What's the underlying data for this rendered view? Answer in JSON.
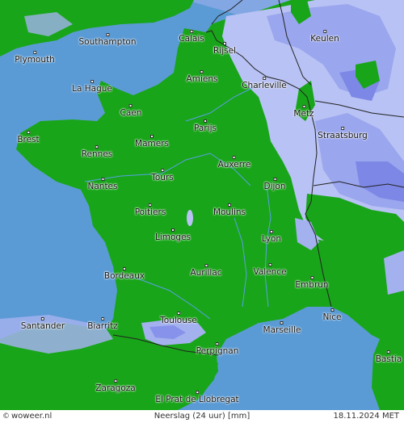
{
  "footer": {
    "credit_symbol": "©",
    "credit": "woweer.nl",
    "legend": "Neerslag (24 uur) [mm]",
    "date": "18.11.2024",
    "timezone": "MET"
  },
  "colors": {
    "sea": "#5b9bd5",
    "land": "#19a519",
    "rain_light": "#b8c2f4",
    "rain_medium": "#9aa6ee",
    "rain_heavy": "#7d88e6",
    "border": "#222222",
    "river": "#5aa0e8"
  },
  "cities": [
    {
      "id": "southampton",
      "name": "Southampton"
    },
    {
      "id": "plymouth",
      "name": "Plymouth"
    },
    {
      "id": "calais",
      "name": "Calais"
    },
    {
      "id": "rijsel",
      "name": "Rijsel"
    },
    {
      "id": "keulen",
      "name": "Keulen"
    },
    {
      "id": "amiens",
      "name": "Amiens"
    },
    {
      "id": "charleville",
      "name": "Charleville"
    },
    {
      "id": "la-hague",
      "name": "La Hague"
    },
    {
      "id": "caen",
      "name": "Caen"
    },
    {
      "id": "metz",
      "name": "Metz"
    },
    {
      "id": "parijs",
      "name": "Parijs"
    },
    {
      "id": "brest",
      "name": "Brest"
    },
    {
      "id": "mamers",
      "name": "Mamers"
    },
    {
      "id": "straatsburg",
      "name": "Straatsburg"
    },
    {
      "id": "rennes",
      "name": "Rennes"
    },
    {
      "id": "auxerre",
      "name": "Auxerre"
    },
    {
      "id": "tours",
      "name": "Tours"
    },
    {
      "id": "nantes",
      "name": "Nantes"
    },
    {
      "id": "dijon",
      "name": "Dijon"
    },
    {
      "id": "poitiers",
      "name": "Poitiers"
    },
    {
      "id": "moulins",
      "name": "Moulins"
    },
    {
      "id": "limoges",
      "name": "Limoges"
    },
    {
      "id": "lyon",
      "name": "Lyon"
    },
    {
      "id": "aurillac",
      "name": "Aurillac"
    },
    {
      "id": "bordeaux",
      "name": "Bordeaux"
    },
    {
      "id": "valence",
      "name": "Valence"
    },
    {
      "id": "embrun",
      "name": "Embrun"
    },
    {
      "id": "nice",
      "name": "Nice"
    },
    {
      "id": "toulouse",
      "name": "Toulouse"
    },
    {
      "id": "santander",
      "name": "Santander"
    },
    {
      "id": "biarritz",
      "name": "Biarritz"
    },
    {
      "id": "marseille",
      "name": "Marseille"
    },
    {
      "id": "perpignan",
      "name": "Perpignan"
    },
    {
      "id": "bastia",
      "name": "Bastia"
    },
    {
      "id": "zaragoza",
      "name": "Zaragoza"
    },
    {
      "id": "el-prat",
      "name": "El Prat de Llobregat"
    }
  ]
}
